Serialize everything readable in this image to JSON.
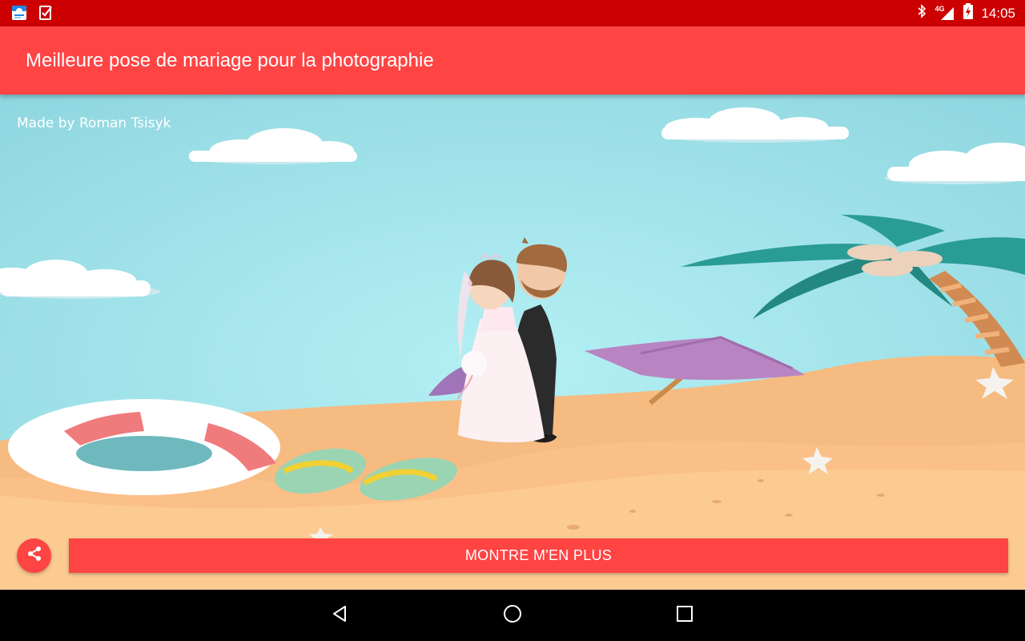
{
  "status_bar": {
    "time": "14:05",
    "network": "4G",
    "icons": [
      "weather-app-icon",
      "task-check-icon",
      "bluetooth-icon",
      "signal-icon",
      "battery-charging-icon"
    ]
  },
  "app_bar": {
    "title": "Meilleure pose de mariage pour la photographie"
  },
  "content": {
    "credit": "Made by Roman Tsisyk",
    "illustration": "beach-wedding-couple-illustration"
  },
  "actions": {
    "share_icon": "share-icon",
    "more_label": "MONTRE M'EN PLUS"
  },
  "nav_bar": {
    "icons": [
      "back-icon",
      "home-icon",
      "recents-icon"
    ]
  },
  "colors": {
    "status_bar": "#cc0000",
    "accent": "#ff4444",
    "sky": "#9ee4ec",
    "sand": "#fbbf7e"
  }
}
